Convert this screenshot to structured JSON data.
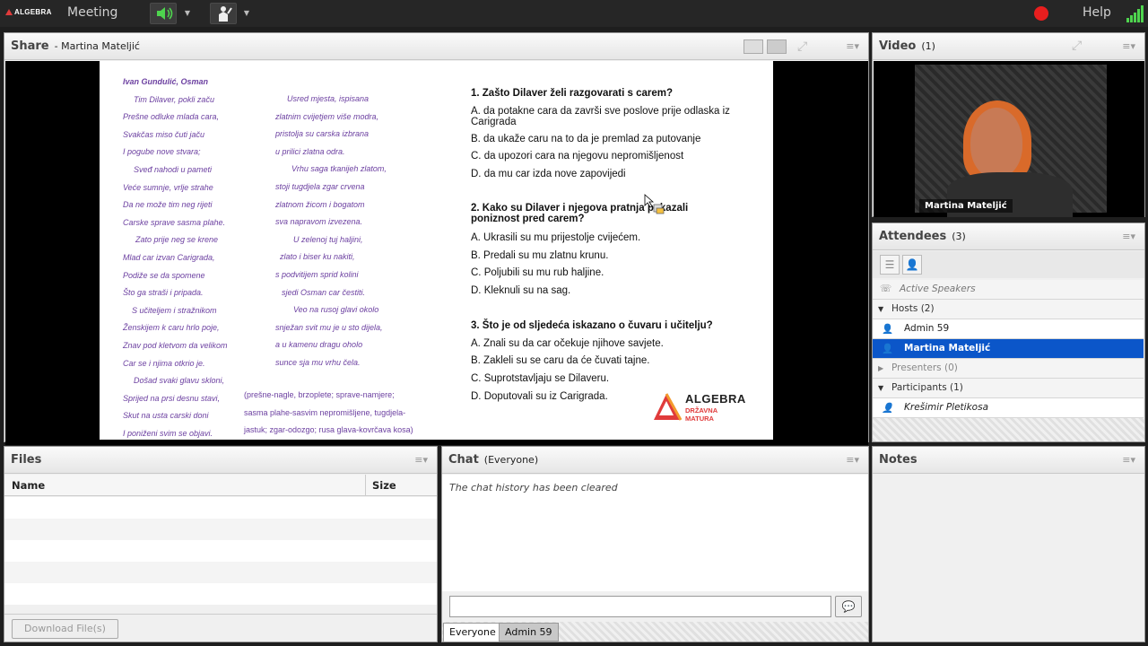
{
  "topbar": {
    "logo": "ALGEBRA",
    "menu_meeting": "Meeting",
    "help": "Help"
  },
  "share": {
    "title": "Share",
    "presenter": "- Martina Mateljić"
  },
  "slide": {
    "poem_col1": [
      "Ivan Gundulić, Osman",
      "Tim Dilaver, pokli začu",
      "Prešne odluke mlada cara,",
      "Svakčas miso čuti jaču",
      "I pogube nove stvara;",
      "Sveđ nahodi u pameti",
      "Veće sumnje, vrlje strahe",
      "Da ne može tim neg rijeti",
      "Carske sprave sasma plahe.",
      "Zato prije neg se krene",
      "Mlad car izvan Carigrada,",
      "Podiže se da spomene",
      "Što ga straši i pripada.",
      "S učiteljem i stražnikom",
      "Ženskijem k caru hrlo poje,",
      "Znav pod kletvom da velikom",
      "Car se i njima otkrio je.",
      "Došad svaki glavu skloni,",
      "Sprijed na prsi desnu stavi,",
      "Skut na usta carski doni",
      "I poniženi svim se objavi."
    ],
    "poem_col2": [
      "Usred mjesta, ispisana",
      "zlatnim cvijetjem više modra,",
      "pristolja su carska izbrana",
      "u prilici zlatna odra.",
      "Vrhu saga tkanijeh zlatom,",
      "stoji tugdjela zgar crvena",
      "zlatnom žicom i bogatom",
      "sva napravom izvezena.",
      "U zelenoj tuj haljini,",
      "zlato i biser ku nakiti,",
      "s podvitijem sprid kolini",
      "sjedi Osman car čestiti.",
      "Veo na rusoj glavi okolo",
      "snježan svit mu je u sto dijela,",
      "a u kamenu dragu oholo",
      "sunce sja mu vrhu čela."
    ],
    "glossary": [
      "(prešne-nagle, brzoplete;  sprave-namjere;",
      "sasma plahe-sasvim nepromišljene, tugdjela-",
      "jastuk; zgar-odozgo; rusa glava-kovrčava kosa)"
    ],
    "q1": {
      "title": "1. Zašto Dilaver želi razgovarati s carem?",
      "answers": [
        "A. da potakne cara da završi sve poslove prije odlaska iz Carigrada",
        "B. da ukaže caru na to da je premlad za putovanje",
        "C. da upozori cara na njegovu nepromišljenost",
        "D. da mu car izda nove zapovijedi"
      ]
    },
    "q2": {
      "title": "2. Kako su Dilaver i njegova pratnja pokazali poniznost pred carem?",
      "answers": [
        "A. Ukrasili su mu prijestolje cvijećem.",
        "B. Predali su mu zlatnu krunu.",
        "C. Poljubili su mu rub haljine.",
        "D. Kleknuli su na sag."
      ]
    },
    "q3": {
      "title": "3. Što je od sljedeća iskazano o čuvaru i učitelju?",
      "answers": [
        "A. Znali su da car očekuje njihove savjete.",
        "B. Zakleli su se caru da će čuvati tajne.",
        "C. Suprotstavljaju se Dilaveru.",
        "D. Doputovali su iz Carigrada."
      ]
    },
    "logo_title": "ALGEBRA",
    "logo_sub1": "DRŽAVNA",
    "logo_sub2": "MATURA"
  },
  "video": {
    "title": "Video",
    "count": "(1)",
    "name": "Martina Mateljić"
  },
  "attendees": {
    "title": "Attendees",
    "count": "(3)",
    "active_speakers": "Active Speakers",
    "hosts_label": "Hosts (2)",
    "hosts": [
      "Admin 59",
      "Martina Mateljić"
    ],
    "presenters_label": "Presenters (0)",
    "participants_label": "Participants (1)",
    "participants": [
      "Krešimir Pletikosa"
    ]
  },
  "files": {
    "title": "Files",
    "col_name": "Name",
    "col_size": "Size",
    "download": "Download File(s)"
  },
  "chat": {
    "title": "Chat",
    "scope": "(Everyone)",
    "history_msg": "The chat history has been cleared",
    "tabs": [
      "Everyone",
      "Admin 59"
    ]
  },
  "notes": {
    "title": "Notes"
  },
  "colors": {
    "accent": "#0b56c9",
    "record": "#e81e1e",
    "signal": "#4ed44e",
    "poem": "#6b3fa0"
  }
}
